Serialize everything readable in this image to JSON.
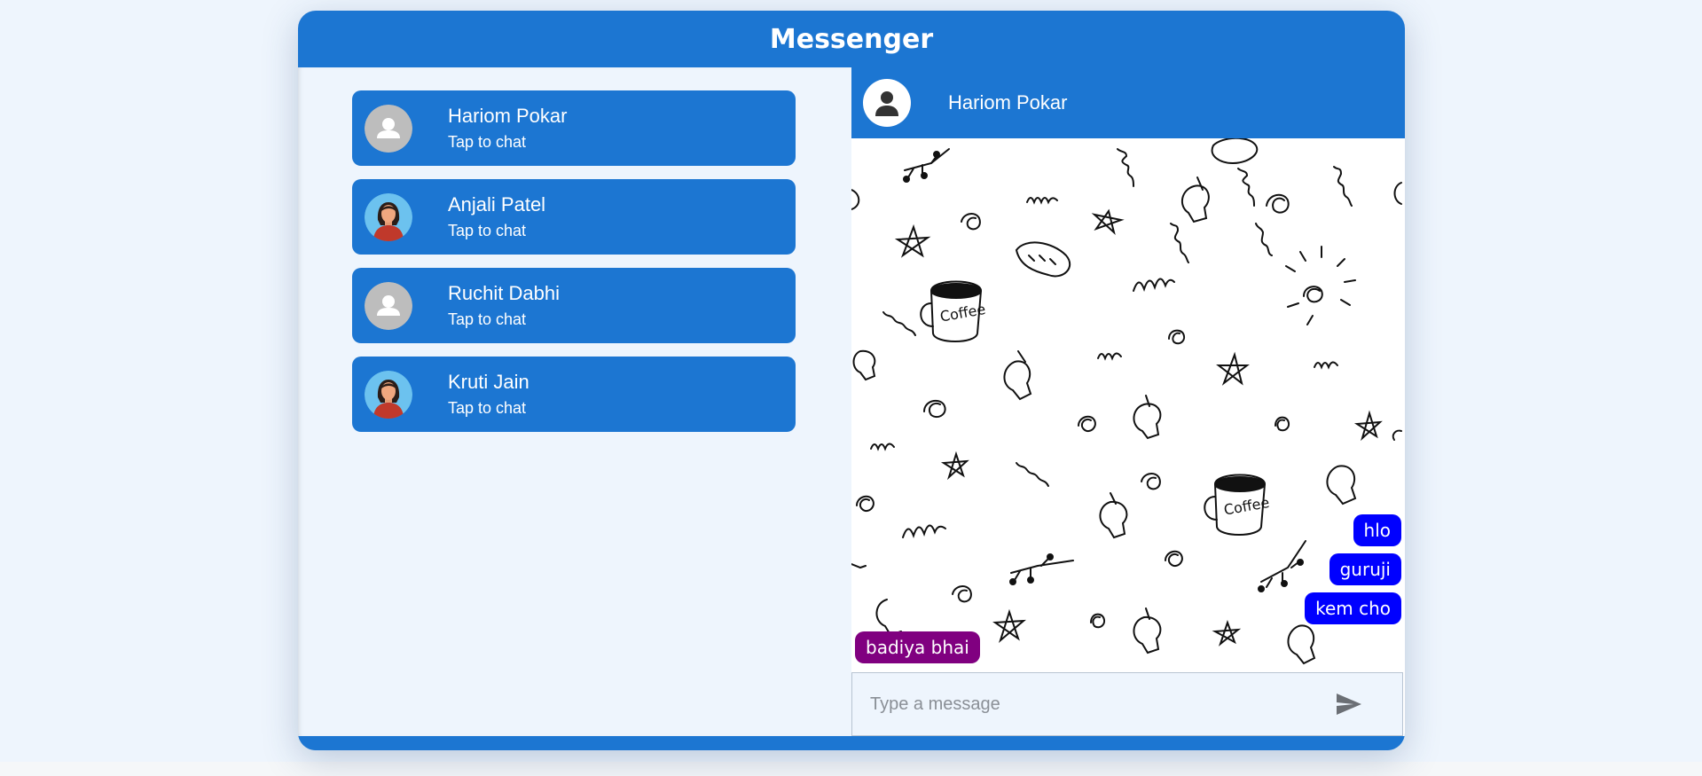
{
  "app": {
    "title": "Messenger"
  },
  "contacts": [
    {
      "name": "Hariom Pokar",
      "subtitle": "Tap to chat",
      "avatar": "default-user-icon"
    },
    {
      "name": "Anjali Patel",
      "subtitle": "Tap to chat",
      "avatar": "female-avatar-icon"
    },
    {
      "name": "Ruchit Dabhi",
      "subtitle": "Tap to chat",
      "avatar": "default-user-icon"
    },
    {
      "name": "Kruti Jain",
      "subtitle": "Tap to chat",
      "avatar": "female-avatar-icon"
    }
  ],
  "chat": {
    "contact_name": "Hariom Pokar",
    "avatar": "user-silhouette-icon",
    "messages": [
      {
        "text": "hlo",
        "direction": "sent"
      },
      {
        "text": "guruji",
        "direction": "sent"
      },
      {
        "text": "kem cho",
        "direction": "sent"
      },
      {
        "text": "badiya bhai",
        "direction": "received"
      }
    ],
    "composer": {
      "placeholder": "Type a message",
      "send_icon": "send-icon"
    }
  },
  "colors": {
    "primary": "#1c76d2",
    "background": "#eef5fd",
    "sent_bubble": "#0000ff",
    "received_bubble": "#800080"
  }
}
